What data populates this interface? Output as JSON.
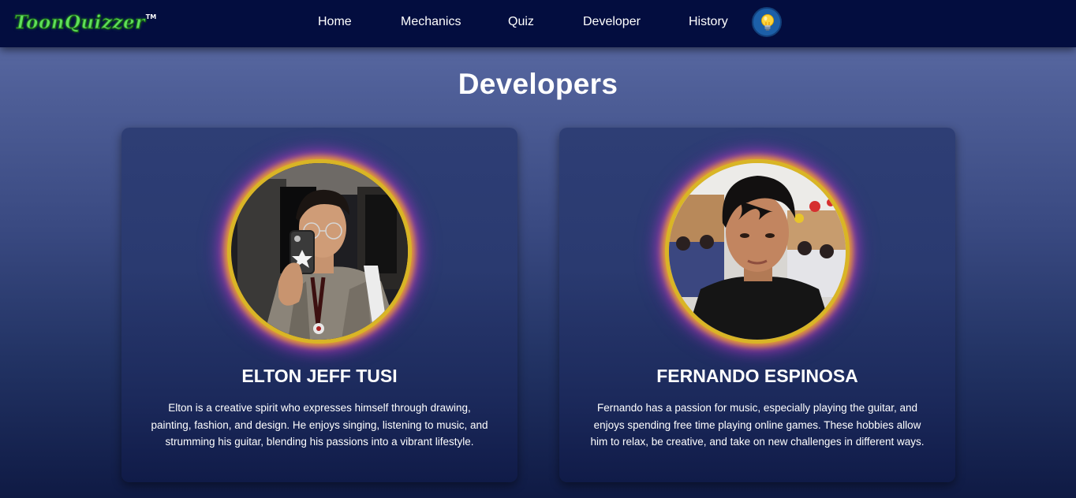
{
  "brand": {
    "name": "ToonQuizzer",
    "trademark": "TM"
  },
  "nav": {
    "items": [
      {
        "label": "Home"
      },
      {
        "label": "Mechanics"
      },
      {
        "label": "Quiz"
      },
      {
        "label": "Developer"
      },
      {
        "label": "History"
      }
    ],
    "theme_toggle_icon": "lightbulb-icon"
  },
  "page": {
    "title": "Developers"
  },
  "developers": [
    {
      "name": "ELTON JEFF TUSI",
      "photo": "developer-photo",
      "bio_lines": [
        "Elton is a creative spirit who expresses himself through drawing,",
        "painting, fashion, and design. He enjoys singing, listening to music, and",
        "strumming his guitar, blending his passions into a vibrant lifestyle."
      ]
    },
    {
      "name": "FERNANDO ESPINOSA",
      "photo": "developer-photo",
      "bio_lines": [
        "Fernando has a passion for music, especially playing the guitar, and",
        "enjoys spending free time playing online games. These hobbies allow",
        "him to relax, be creative, and take on new challenges in different ways."
      ]
    }
  ],
  "colors": {
    "navbar": "#030d3f",
    "logo_green": "#5ee05a",
    "ring_gold": "#d9b526",
    "glow_purple": "#c83cc8",
    "toggle_blue": "#1c5fa8"
  }
}
